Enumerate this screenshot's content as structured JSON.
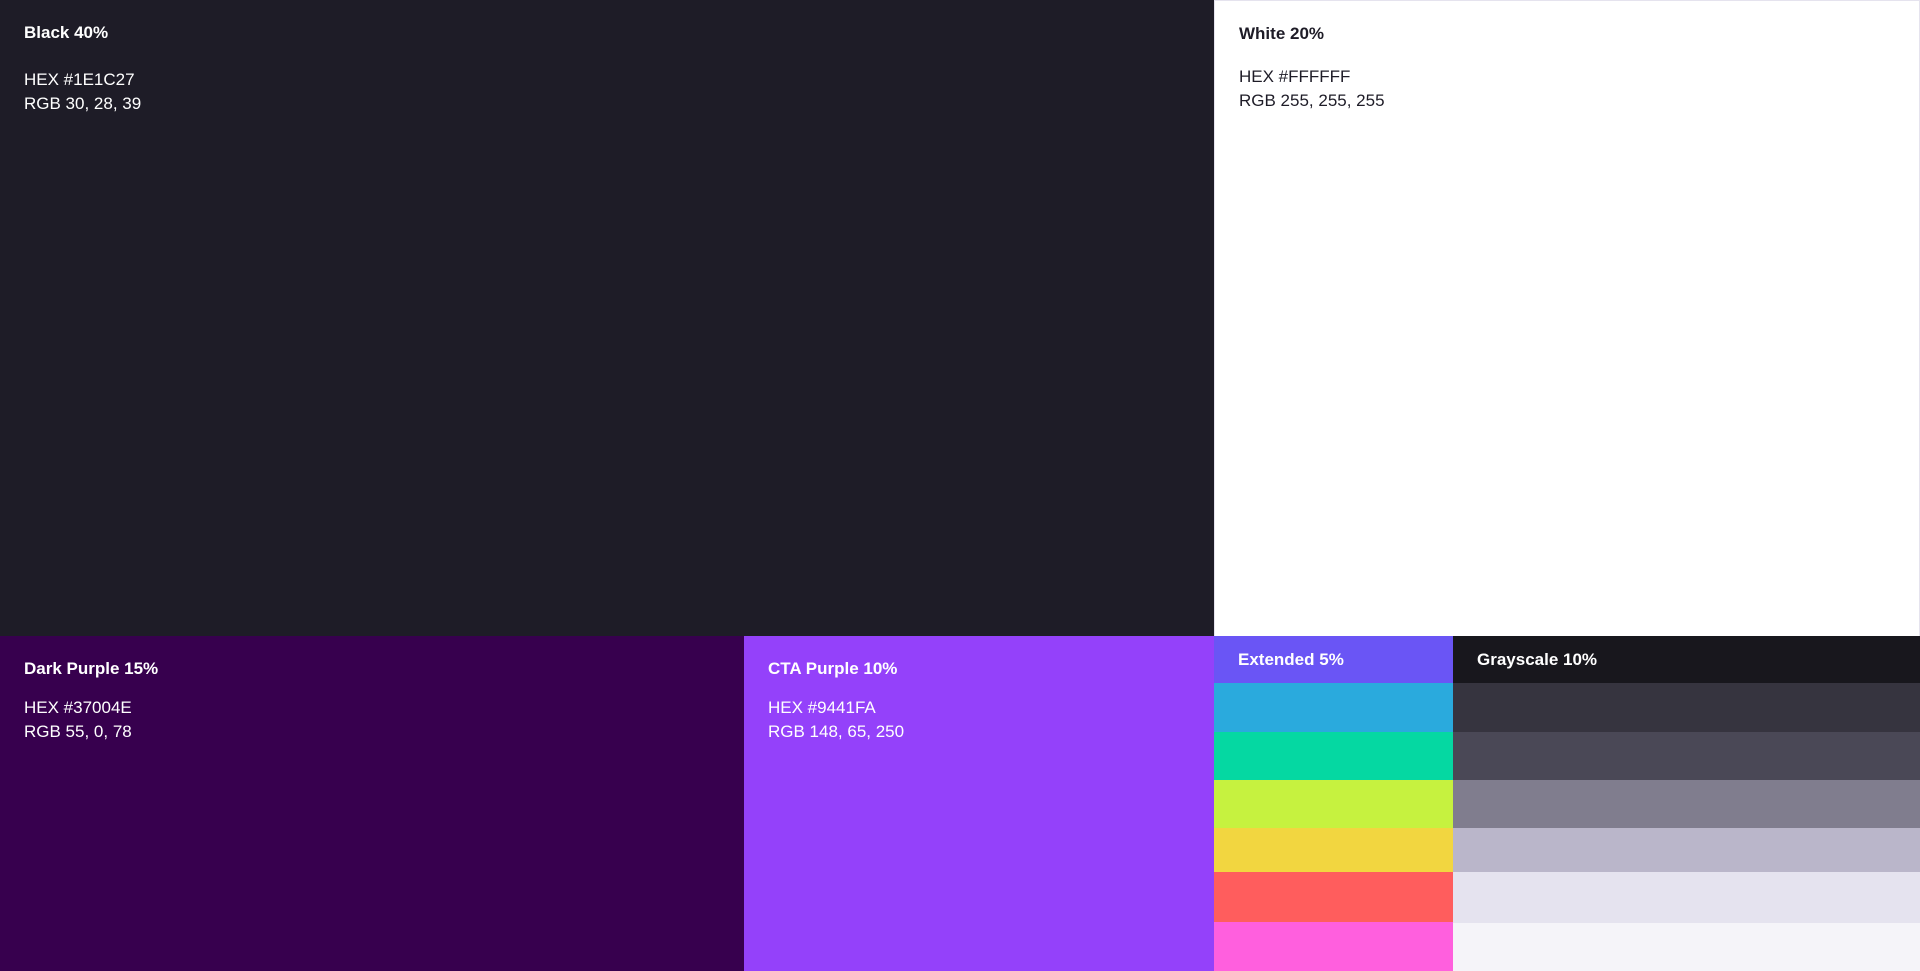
{
  "black": {
    "label": "Black 40%",
    "hex": "HEX #1E1C27",
    "rgb": "RGB 30, 28, 39",
    "color": "#1e1c27"
  },
  "white": {
    "label": "White 20%",
    "hex": "HEX #FFFFFF",
    "rgb": "RGB 255, 255, 255",
    "color": "#ffffff"
  },
  "dark_purple": {
    "label": "Dark Purple 15%",
    "hex": "HEX #37004E",
    "rgb": "RGB 55, 0, 78",
    "color": "#37004e"
  },
  "cta_purple": {
    "label": "CTA Purple 10%",
    "hex": "HEX #9441FA",
    "rgb": "RGB 148, 65, 250",
    "color": "#9441fa"
  },
  "extended": {
    "label": "Extended 5%",
    "colors": [
      "#6a55f5",
      "#2aaadd",
      "#05d8a2",
      "#c6f23f",
      "#f2d640",
      "#ff5d5d",
      "#ff5fde"
    ]
  },
  "grayscale": {
    "label": "Grayscale 10%",
    "colors": [
      "#18171d",
      "#36343f",
      "#4a4856",
      "#807d8e",
      "#bab6ca",
      "#e5e3ef",
      "#f5f4f9"
    ]
  }
}
